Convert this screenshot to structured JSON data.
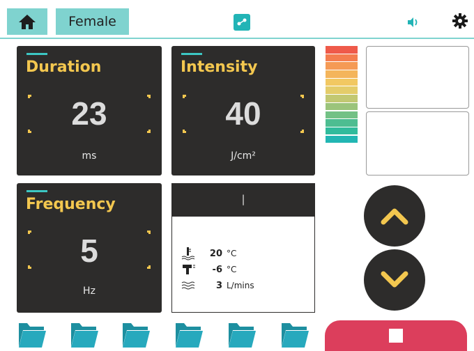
{
  "header": {
    "home_icon": "home-icon",
    "gender_label": "Female",
    "center_icon": "connection-icon",
    "speaker_icon": "speaker-icon",
    "settings_icon": "gear-icon",
    "accent_color": "#7fd3cf"
  },
  "duration": {
    "title": "Duration",
    "value": "23",
    "unit": "ms"
  },
  "intensity": {
    "title": "Intensity",
    "value": "40",
    "unit": "J/cm²"
  },
  "frequency": {
    "title": "Frequency",
    "value": "5",
    "unit": "Hz"
  },
  "status": {
    "header_text": "|",
    "rows": [
      {
        "icon": "water-temperature-icon",
        "value": "20",
        "unit": "°C"
      },
      {
        "icon": "handpiece-icon",
        "value": "-6",
        "unit": "°C"
      },
      {
        "icon": "flow-icon",
        "value": "3",
        "unit": "L/mins"
      }
    ]
  },
  "scale_colors": [
    "#ef5a4a",
    "#f47d4f",
    "#f59a55",
    "#f4b55b",
    "#f2c862",
    "#e4cc6a",
    "#c2c872",
    "#9bc47b",
    "#73c185",
    "#4dbd91",
    "#30bb9c",
    "#22b6b3"
  ],
  "controls": {
    "up_icon": "chevron-up-icon",
    "down_icon": "chevron-down-icon",
    "stop_icon": "stop-icon"
  },
  "folders": [
    "folder-icon",
    "folder-icon",
    "folder-icon",
    "folder-icon",
    "folder-icon",
    "folder-icon"
  ]
}
